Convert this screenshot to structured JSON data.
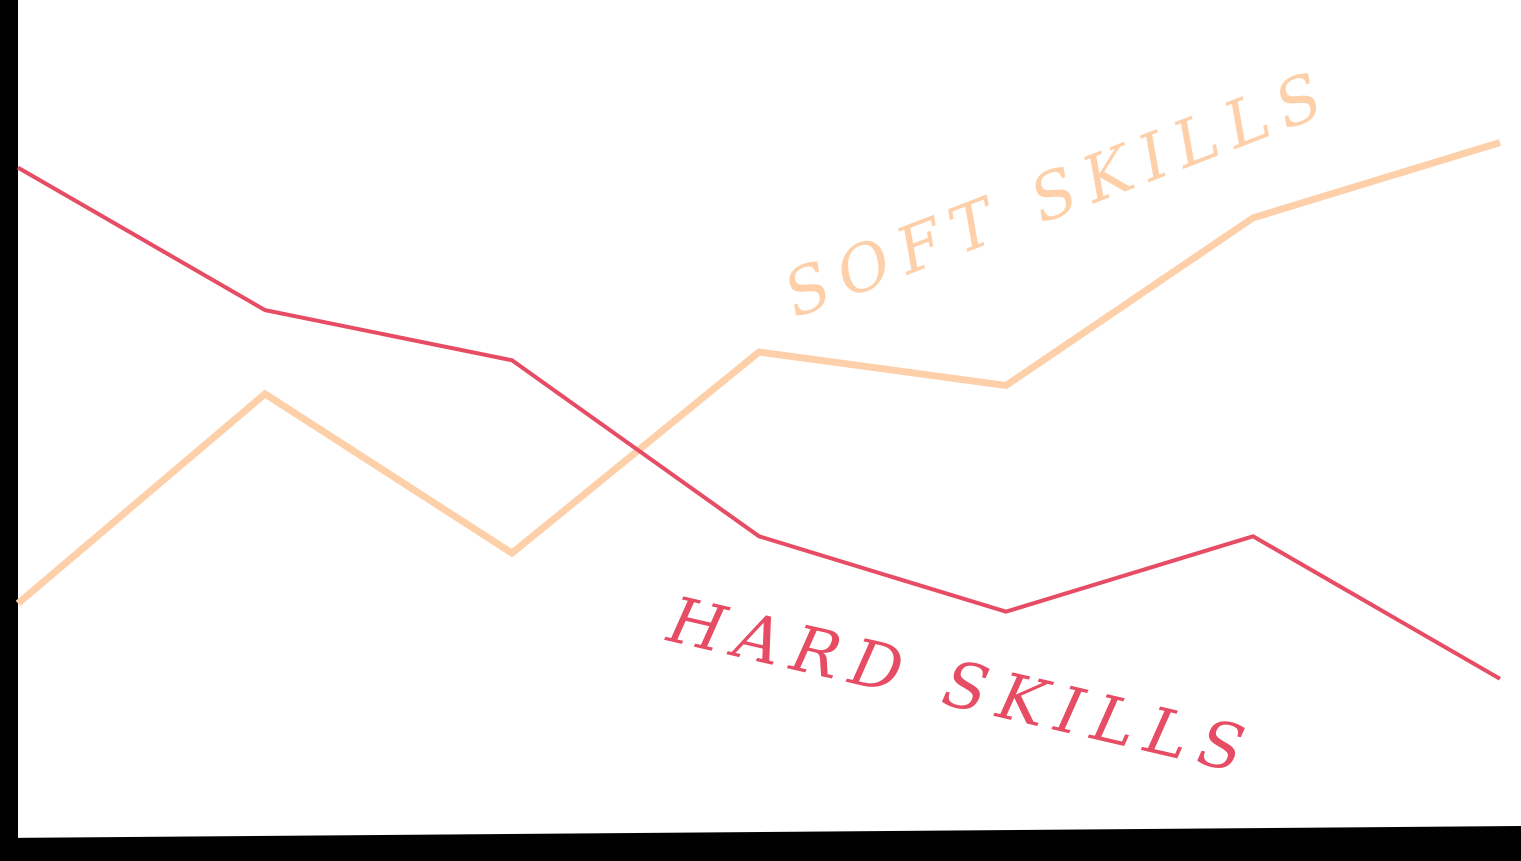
{
  "chart_data": {
    "type": "line",
    "title": "",
    "xlabel": "",
    "ylabel": "",
    "x": [
      1,
      2,
      3,
      4,
      5,
      6,
      7
    ],
    "ylim": [
      0,
      100
    ],
    "grid": false,
    "legend": "none",
    "series": [
      {
        "key": "hard",
        "name": "HARD SKILLS",
        "color": "#e64c64",
        "values": [
          80,
          63,
          57,
          36,
          27,
          36,
          19
        ]
      },
      {
        "key": "soft",
        "name": "SOFT SKILLS",
        "color": "#fdd0aa",
        "x": [
          1,
          2,
          3,
          4,
          5,
          6,
          7
        ],
        "values": [
          28,
          53,
          34,
          58,
          54,
          74,
          83
        ]
      }
    ]
  }
}
